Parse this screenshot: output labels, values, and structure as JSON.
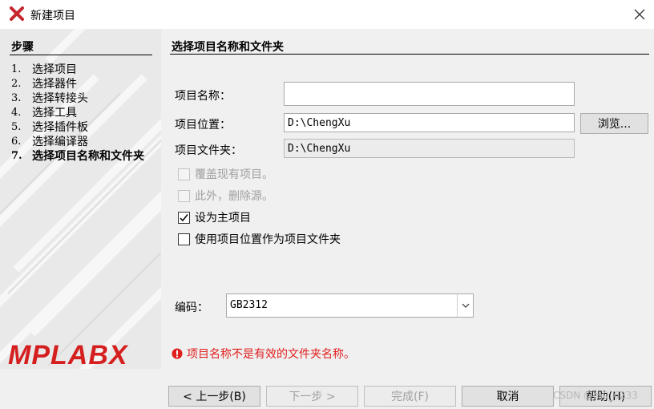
{
  "window": {
    "title": "新建项目",
    "close_glyph": "✕"
  },
  "steps": {
    "title": "步骤",
    "items": [
      {
        "num": "1.",
        "label": "选择项目"
      },
      {
        "num": "2.",
        "label": "选择器件"
      },
      {
        "num": "3.",
        "label": "选择转接头"
      },
      {
        "num": "4.",
        "label": "选择工具"
      },
      {
        "num": "5.",
        "label": "选择插件板"
      },
      {
        "num": "6.",
        "label": "选择编译器"
      },
      {
        "num": "7.",
        "label": "选择项目名称和文件夹"
      }
    ],
    "active_index": 6,
    "brand": "MPLABX"
  },
  "page": {
    "title": "选择项目名称和文件夹",
    "project_name": {
      "label": "项目名称：",
      "value": ""
    },
    "project_location": {
      "label": "项目位置：",
      "value": "D:\\ChengXu"
    },
    "browse_button": "浏览...",
    "project_folder": {
      "label": "项目文件夹：",
      "value": "D:\\ChengXu"
    },
    "options": [
      {
        "label": "覆盖现有项目。",
        "checked": false,
        "enabled": false
      },
      {
        "label": "此外，删除源。",
        "checked": false,
        "enabled": false
      },
      {
        "label": "设为主项目",
        "checked": true,
        "enabled": true
      },
      {
        "label": "使用项目位置作为项目文件夹",
        "checked": false,
        "enabled": true
      }
    ],
    "encoding": {
      "label": "编码：",
      "value": "GB2312"
    },
    "error_message": "项目名称不是有效的文件夹名称。"
  },
  "buttons": {
    "back": "< 上一步(B)",
    "next": "下一步 >",
    "finish": "完成(F)",
    "cancel": "取消",
    "help": "帮助(H)"
  },
  "watermark": "CSDN @m0_6233",
  "colors": {
    "error": "#e01e1e",
    "brand": "#d51f1f"
  }
}
